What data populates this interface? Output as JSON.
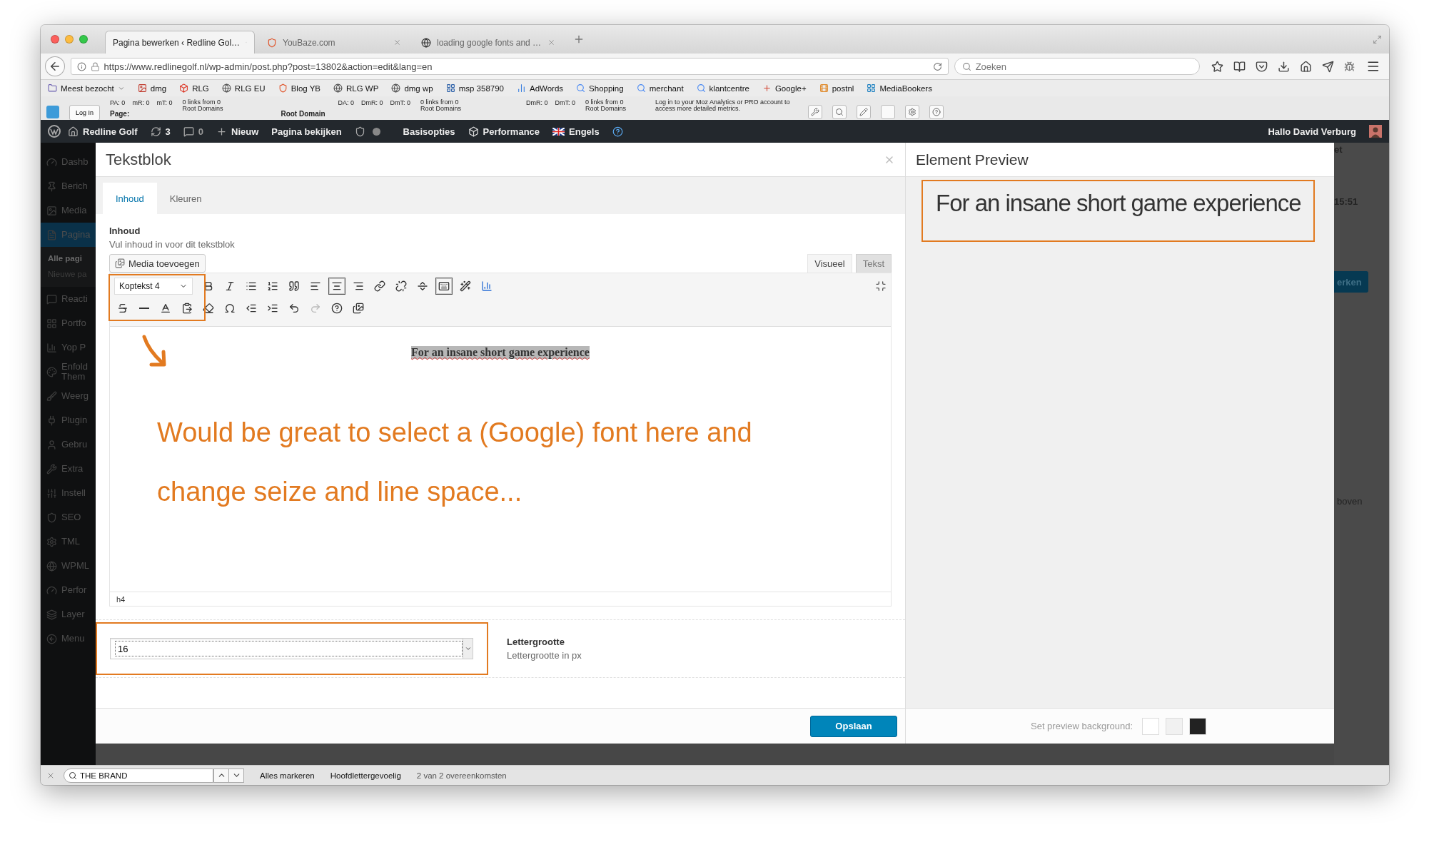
{
  "browser": {
    "tabs": [
      {
        "title": "Pagina bewerken ‹ Redline Gol…",
        "selected": true
      },
      {
        "title": "YouBaze.com",
        "selected": false
      },
      {
        "title": "loading google fonts and …",
        "selected": false
      }
    ],
    "url": "https://www.redlinegolf.nl/wp-admin/post.php?post=13802&action=edit&lang=en",
    "search": {
      "placeholder": "Zoeken"
    },
    "bookmarks": [
      "Meest bezocht",
      "dmg",
      "RLG",
      "RLG EU",
      "Blog YB",
      "RLG WP",
      "dmg wp",
      "msp 358790",
      "AdWords",
      "Shopping",
      "merchant",
      "klantcentre",
      "Google+",
      "postnl",
      "MediaBookers"
    ]
  },
  "moz_bar": {
    "login": "Log In",
    "page_label": "Page:",
    "page_metrics": [
      "PA: 0",
      "mR: 0",
      "mT: 0"
    ],
    "page_links": "0 links from 0 Root Domains",
    "domain_label": "Root Domain",
    "domain_metrics": [
      "DA: 0",
      "DmR: 0",
      "DmT: 0"
    ],
    "domain_links": "0 links from 0 Root Domains",
    "subdomain_metrics": [
      "DmR: 0",
      "DmT: 0"
    ],
    "subdomain_links": "0 links from 0 Root Domains",
    "login_hint": "Log in to your Moz Analytics or PRO account to access more detailed metrics."
  },
  "admin_bar": {
    "site": "Redline Golf",
    "updates": "3",
    "comments": "0",
    "new": "Nieuw",
    "view": "Pagina bekijken",
    "options": "Basisopties",
    "performance": "Performance",
    "language": "Engels",
    "greeting": "Hallo David Verburg"
  },
  "sidebar": {
    "items": [
      {
        "label": "Dashb",
        "selected": false
      },
      {
        "label": "Berich",
        "selected": false
      },
      {
        "label": "Media",
        "selected": false
      },
      {
        "label": "Pagina",
        "selected": true,
        "children": [
          {
            "label": "Alle pagi",
            "selected": true
          },
          {
            "label": "Nieuwe pa",
            "selected": false
          }
        ]
      },
      {
        "label": "Reacti",
        "selected": false
      },
      {
        "label": "Portfo",
        "selected": false
      },
      {
        "label": "Yop P",
        "selected": false
      },
      {
        "label": "Enfold Them",
        "selected": false
      },
      {
        "label": "Weerg",
        "selected": false
      },
      {
        "label": "Plugin",
        "selected": false
      },
      {
        "label": "Gebru",
        "selected": false
      },
      {
        "label": "Extra",
        "selected": false
      },
      {
        "label": "Instell",
        "selected": false
      },
      {
        "label": "SEO",
        "selected": false
      },
      {
        "label": "TML",
        "selected": false
      },
      {
        "label": "WPML",
        "selected": false
      },
      {
        "label": "Perfor",
        "selected": false
      },
      {
        "label": "Layer",
        "selected": false
      },
      {
        "label": "Menu",
        "selected": false
      }
    ]
  },
  "modal": {
    "title": "Tekstblok",
    "tabs": [
      {
        "label": "Inhoud",
        "selected": true
      },
      {
        "label": "Kleuren",
        "selected": false
      }
    ],
    "field_label": "Inhoud",
    "field_help": "Vul inhoud in voor dit tekstblok",
    "media_button": "Media toevoegen",
    "editor_tabs": [
      {
        "label": "Visueel",
        "selected": true
      },
      {
        "label": "Tekst",
        "selected": false
      }
    ],
    "format": "Koptekst 4",
    "toolbar_rows": [
      [
        {
          "selected": false,
          "disabled": false
        },
        {
          "selected": false,
          "disabled": false
        },
        {
          "selected": false,
          "disabled": false
        },
        {
          "selected": false,
          "disabled": false
        },
        {
          "selected": false,
          "disabled": false
        },
        {
          "selected": false,
          "disabled": false
        },
        {
          "selected": true,
          "disabled": false
        },
        {
          "selected": false,
          "disabled": false
        },
        {
          "selected": false,
          "disabled": false
        },
        {
          "selected": false,
          "disabled": false
        },
        {
          "selected": false,
          "disabled": false
        },
        {
          "selected": true,
          "disabled": false
        },
        {
          "selected": false,
          "disabled": false
        },
        {
          "selected": false,
          "disabled": false
        }
      ],
      [
        {
          "selected": false,
          "disabled": false
        },
        {
          "selected": false,
          "disabled": false
        },
        {
          "selected": false,
          "disabled": false
        },
        {
          "selected": false,
          "disabled": false
        },
        {
          "selected": false,
          "disabled": false
        },
        {
          "selected": false,
          "disabled": false
        },
        {
          "selected": false,
          "disabled": false
        },
        {
          "selected": false,
          "disabled": false
        },
        {
          "selected": false,
          "disabled": false
        },
        {
          "selected": false,
          "disabled": true
        },
        {
          "selected": false,
          "disabled": false
        },
        {
          "selected": false,
          "disabled": false
        }
      ]
    ],
    "heading": {
      "text": "For an insane short game experience",
      "highlighted": true
    },
    "path": "h4",
    "font_size": {
      "value": "16",
      "label": "Lettergrootte",
      "help": "Lettergrootte in px"
    },
    "save": "Opslaan"
  },
  "annotation": {
    "lines": [
      "Would be great to select a (Google) font here and",
      "change seize and line space..."
    ]
  },
  "preview": {
    "title": "Element Preview",
    "text": "For an insane short game experience",
    "background_label": "Set preview background:",
    "swatches": [
      {
        "color": "#ffffff"
      },
      {
        "color": "#f1f1f1"
      },
      {
        "color": "#222222"
      }
    ]
  },
  "background": {
    "top": "et",
    "time": "15:51",
    "button": "erken",
    "note": "boven"
  },
  "find_bar": {
    "query": "THE BRAND",
    "highlight_all": "Alles markeren",
    "match_case": "Hoofdlettergevoelig",
    "result": "2 van 2 overeenkomsten"
  }
}
